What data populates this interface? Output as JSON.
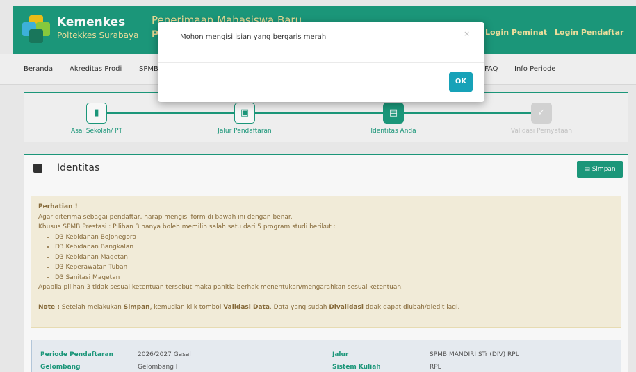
{
  "header": {
    "brand_name": "Kemenkes",
    "brand_sub": "Poltekkes Surabaya",
    "site_title": "Penerimaan Mahasiswa Baru",
    "site_title_2": "P",
    "login_peminat": "Login Peminat",
    "login_pendaftar": "Login Pendaftar"
  },
  "nav": {
    "items": [
      "Beranda",
      "Akreditas Prodi",
      "SPMB",
      "FAQ",
      "Info Periode"
    ]
  },
  "steps": [
    {
      "label": "Asal Sekolah/ PT",
      "icon": "book-icon",
      "state": "done"
    },
    {
      "label": "Jalur Pendaftaran",
      "icon": "calendar-icon",
      "state": "done"
    },
    {
      "label": "Identitas Anda",
      "icon": "id-card-icon",
      "state": "active"
    },
    {
      "label": "Validasi Pernyataan",
      "icon": "check-icon",
      "state": "disabled"
    }
  ],
  "panel": {
    "title": "Identitas",
    "save_label": "Simpan"
  },
  "alert": {
    "title": "Perhatian !",
    "line1": "Agar diterima sebagai pendaftar, harap mengisi form di bawah ini dengan benar.",
    "line2": "Khusus SPMB Prestasi : Pilihan 3 hanya boleh memilih salah satu dari 5 program studi berikut :",
    "programs": [
      "D3 Kebidanan Bojonegoro",
      "D3 Kebidanan Bangkalan",
      "D3 Kebidanan Magetan",
      "D3 Keperawatan Tuban",
      "D3 Sanitasi Magetan"
    ],
    "line3": "Apabila pilihan 3 tidak sesuai ketentuan tersebut maka panitia berhak menentukan/mengarahkan sesuai ketentuan.",
    "note_label": "Note :",
    "note_1": " Setelah melakukan ",
    "note_simpan": "Simpan",
    "note_2": ", kemudian klik tombol ",
    "note_validasi": "Validasi Data",
    "note_3": ". Data yang sudah ",
    "note_divalidasi": "Divalidasi",
    "note_4": " tidak dapat diubah/diedit lagi."
  },
  "info": {
    "periode_label": "Periode Pendaftaran",
    "periode_value": "2026/2027 Gasal",
    "jalur_label": "Jalur",
    "jalur_value": "SPMB MANDIRI STr (DIV) RPL",
    "gelombang_label": "Gelombang",
    "gelombang_value": "Gelombang I",
    "sistem_label": "Sistem Kuliah",
    "sistem_value": "RPL"
  },
  "modal": {
    "message": "Mohon mengisi isian yang bergaris merah",
    "close": "×",
    "ok_label": "OK"
  },
  "colors": {
    "primary": "#1c9b7d",
    "accent_yellow": "#f2e4a0",
    "ok_button": "#17a2b8",
    "alert_bg": "#f9f3df"
  }
}
